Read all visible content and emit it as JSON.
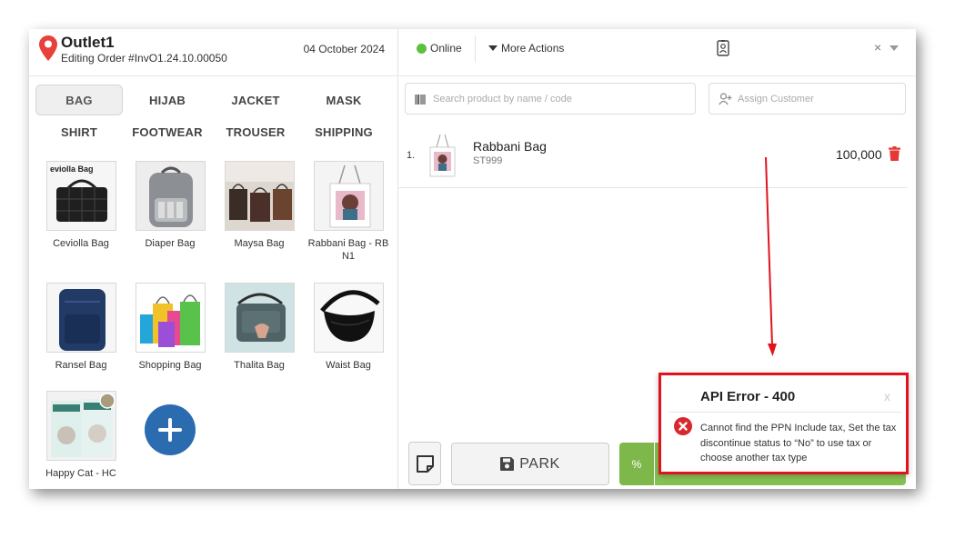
{
  "header": {
    "outlet_name": "Outlet1",
    "order_label": "Editing Order #InvO1.24.10.00050",
    "date": "04 October 2024",
    "status": "Online",
    "more_actions": "More Actions",
    "close_label": "×"
  },
  "categories": [
    "BAG",
    "HIJAB",
    "JACKET",
    "MASK",
    "SHIRT",
    "FOOTWEAR",
    "TROUSER",
    "SHIPPING"
  ],
  "active_category": "BAG",
  "products": [
    {
      "name": "Ceviolla Bag",
      "thumb_caption": "eviolla Bag"
    },
    {
      "name": "Diaper Bag"
    },
    {
      "name": "Maysa Bag"
    },
    {
      "name": "Rabbani Bag - RB N1"
    },
    {
      "name": "Ransel Bag"
    },
    {
      "name": "Shopping Bag"
    },
    {
      "name": "Thalita Bag"
    },
    {
      "name": "Waist Bag"
    },
    {
      "name": "Happy Cat - HC"
    }
  ],
  "search": {
    "placeholder": "Search product by name / code"
  },
  "assign_customer": {
    "placeholder": "Assign Customer"
  },
  "cart": [
    {
      "index": "1.",
      "name": "Rabbani Bag",
      "code": "ST999",
      "price": "100,000"
    }
  ],
  "actions": {
    "park_label": "PARK",
    "discount_label": "%"
  },
  "error": {
    "title": "API Error - 400",
    "close": "x",
    "message": "Cannot find the PPN Include tax, Set the tax discontinue status to “No” to use tax or choose another tax type"
  },
  "colors": {
    "accent": "#2b6cb0",
    "online": "#5cc040",
    "pay": "#86c053",
    "error": "#e0141d",
    "trash": "#e53935"
  }
}
